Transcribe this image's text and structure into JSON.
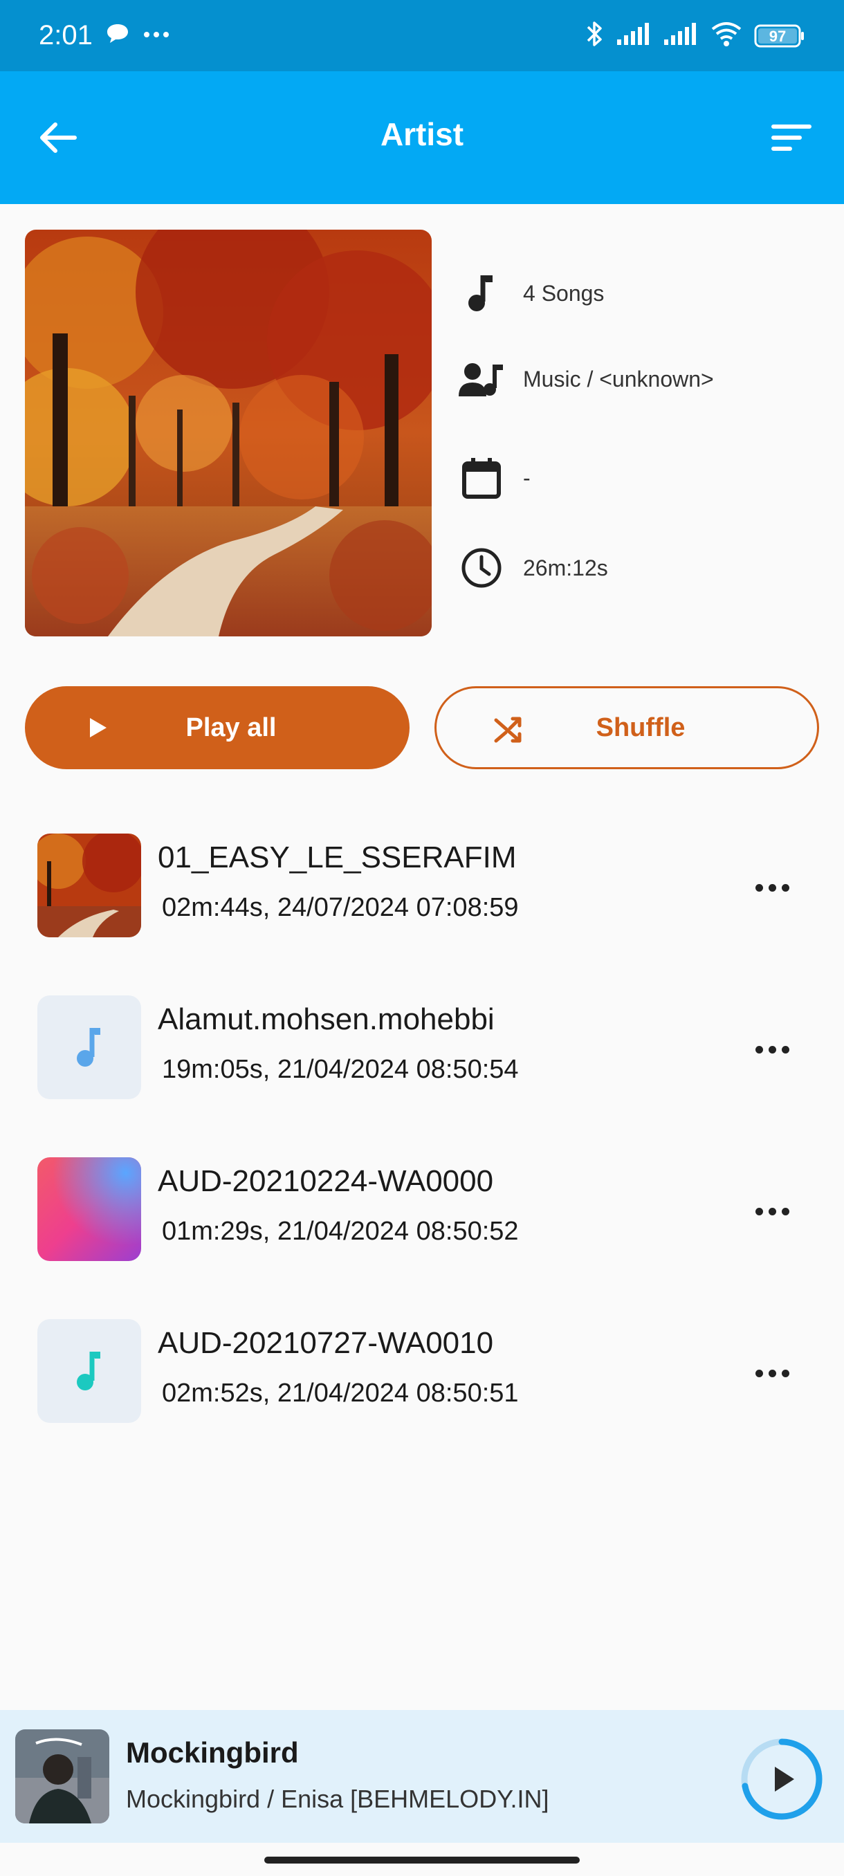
{
  "status_bar": {
    "time": "2:01",
    "battery": "97"
  },
  "app_bar": {
    "title": "Artist",
    "back_icon": "arrow-left-icon",
    "sort_icon": "sort-icon"
  },
  "album_info": {
    "songs": "4 Songs",
    "artist": "Music / <unknown>",
    "year": "-",
    "duration": "26m:12s"
  },
  "actions": {
    "play_all": "Play all",
    "shuffle": "Shuffle"
  },
  "colors": {
    "status_bar": "#0590cf",
    "app_bar": "#03a9f4",
    "accent": "#d0601a",
    "mini_player_bg": "#e1f1fb",
    "progress": "#1fa0ea"
  },
  "songs": [
    {
      "title": "01_EASY_LE_SSERAFIM",
      "subtitle": "02m:44s, 24/07/2024 07:08:59",
      "thumb": "autumn-artwork"
    },
    {
      "title": "Alamut.mohsen.mohebbi",
      "subtitle": "19m:05s, 21/04/2024 08:50:54",
      "thumb": "music-note-blue"
    },
    {
      "title": "AUD-20210224-WA0000",
      "subtitle": "01m:29s, 21/04/2024 08:50:52",
      "thumb": "gradient-artwork"
    },
    {
      "title": "AUD-20210727-WA0010",
      "subtitle": "02m:52s, 21/04/2024 08:50:51",
      "thumb": "music-note-teal"
    }
  ],
  "mini_player": {
    "title": "Mockingbird",
    "subtitle": "Mockingbird / Enisa [BEHMELODY.IN]",
    "progress": 0.72
  }
}
